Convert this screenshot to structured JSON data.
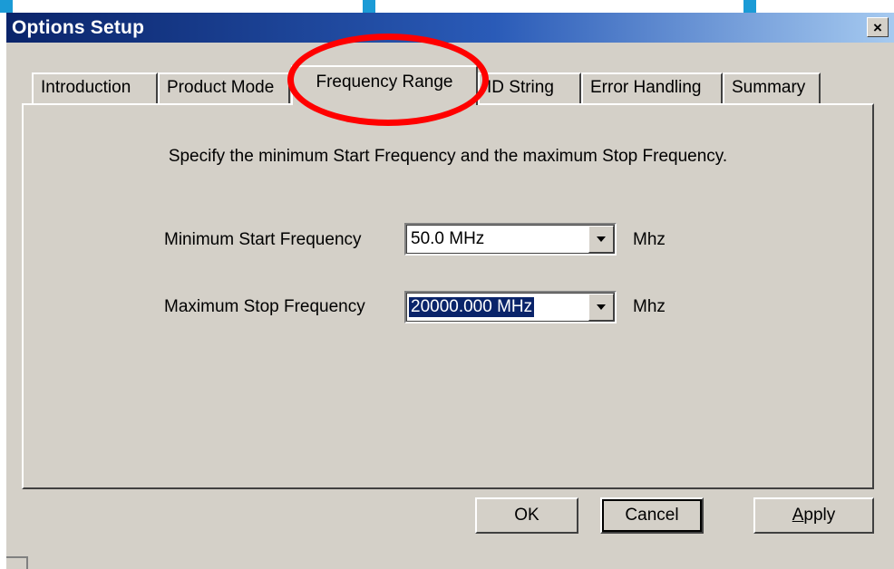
{
  "window": {
    "title": "Options Setup",
    "close_symbol": "×"
  },
  "tabs": [
    {
      "label": "Introduction",
      "active": false
    },
    {
      "label": "Product Mode",
      "active": false
    },
    {
      "label": "Frequency Range",
      "active": true
    },
    {
      "label": "ID String",
      "active": false
    },
    {
      "label": "Error Handling",
      "active": false
    },
    {
      "label": "Summary",
      "active": false
    }
  ],
  "panel": {
    "instruction": "Specify the minimum Start Frequency and the maximum Stop Frequency.",
    "min_start": {
      "label": "Minimum Start Frequency",
      "value": "50.0 MHz",
      "unit": "Mhz"
    },
    "max_stop": {
      "label": "Maximum Stop Frequency",
      "value": "20000.000 MHz",
      "unit": "Mhz"
    }
  },
  "buttons": {
    "ok": "OK",
    "cancel": "Cancel",
    "apply_mnemonic": "A",
    "apply_rest": "pply"
  },
  "colors": {
    "titlebar_start": "#0a246a",
    "titlebar_end": "#a6caf0",
    "selection": "#0a246a",
    "annotation": "#ff0000",
    "accent": "#1b9bd6"
  },
  "icons": {
    "close": "close-icon",
    "dropdown": "chevron-down-icon"
  }
}
